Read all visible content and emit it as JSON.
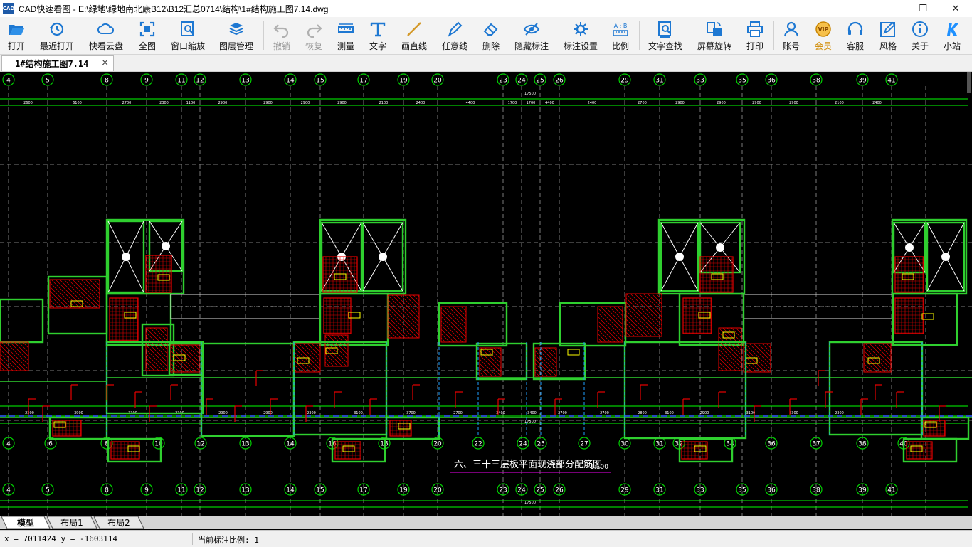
{
  "window": {
    "app_icon_text": "CAD",
    "title": "CAD快速看图 - E:\\绿地\\绿地南北康B12\\B12汇总0714\\结构\\1#结构施工图7.14.dwg",
    "minimize_glyph": "—",
    "maximize_glyph": "❐",
    "close_glyph": "✕"
  },
  "toolbar": {
    "open": "打开",
    "recent": "最近打开",
    "cloud": "快看云盘",
    "fit_all": "全图",
    "window_zoom": "窗口缩放",
    "layers": "图层管理",
    "undo": "撤销",
    "redo": "恢复",
    "measure": "测量",
    "text": "文字",
    "line": "画直线",
    "freehand": "任意线",
    "erase": "删除",
    "hide_annotations": "隐藏标注",
    "annotation_settings": "标注设置",
    "scale": "比例",
    "text_search": "文字查找",
    "rotate_screen": "屏幕旋转",
    "print": "打印",
    "account": "账号",
    "vip": "会员",
    "service": "客服",
    "style": "风格",
    "about": "关于",
    "mini_site": "小站",
    "scale_icon_text": "A : B",
    "vip_icon_text": "VIP"
  },
  "document_tab": {
    "label": "1#结构施工图7.14",
    "close": "×"
  },
  "drawing": {
    "title": "六、三十三层板平面现浇部分配筋图",
    "scale": "1:100",
    "axis_top": [
      "4",
      "5",
      "8",
      "9",
      "11",
      "12",
      "13",
      "14",
      "15",
      "17",
      "19",
      "20",
      "23",
      "24",
      "25",
      "26",
      "29",
      "31",
      "33",
      "35",
      "36",
      "38",
      "39",
      "41"
    ],
    "axis_bottom": [
      "4",
      "6",
      "8",
      "10",
      "12",
      "13",
      "14",
      "16",
      "18",
      "20",
      "22",
      "24",
      "25",
      "27",
      "30",
      "31",
      "32",
      "34",
      "36",
      "37",
      "38",
      "40"
    ],
    "axis_third": [
      "4",
      "5",
      "8",
      "9",
      "11",
      "12",
      "13",
      "14",
      "15",
      "17",
      "19",
      "20",
      "23",
      "24",
      "25",
      "26",
      "29",
      "31",
      "33",
      "35",
      "36",
      "38",
      "39",
      "41"
    ],
    "dims_top": [
      "2600",
      "6100",
      "2700",
      "2300",
      "1100",
      "2900",
      "2900",
      "2900",
      "2900",
      "2100",
      "2400",
      "4400",
      "1700",
      "1700",
      "4400",
      "2400",
      "2700",
      "2900",
      "2900",
      "2900",
      "2900",
      "2100",
      "2400"
    ],
    "dims_bottom": [
      "2300",
      "3900",
      "3300",
      "2300",
      "2900",
      "2900",
      "2300",
      "3100",
      "3700",
      "2700",
      "3400",
      "3400",
      "2700",
      "2700",
      "2800",
      "3100",
      "2900",
      "3100",
      "3300",
      "2300"
    ],
    "overall_dim": "17500",
    "ring_color": "#00d200",
    "line_color": "#00ff00",
    "wall_color": "#3cc83c",
    "rebar_color": "#e80000",
    "label_color": "#ffff00",
    "grid_color": "#7a7a7a"
  },
  "layout_tabs": [
    "模型",
    "布局1",
    "布局2"
  ],
  "status": {
    "coords": "x = 7011424  y = -1603114",
    "annotation_scale": "当前标注比例: 1"
  }
}
